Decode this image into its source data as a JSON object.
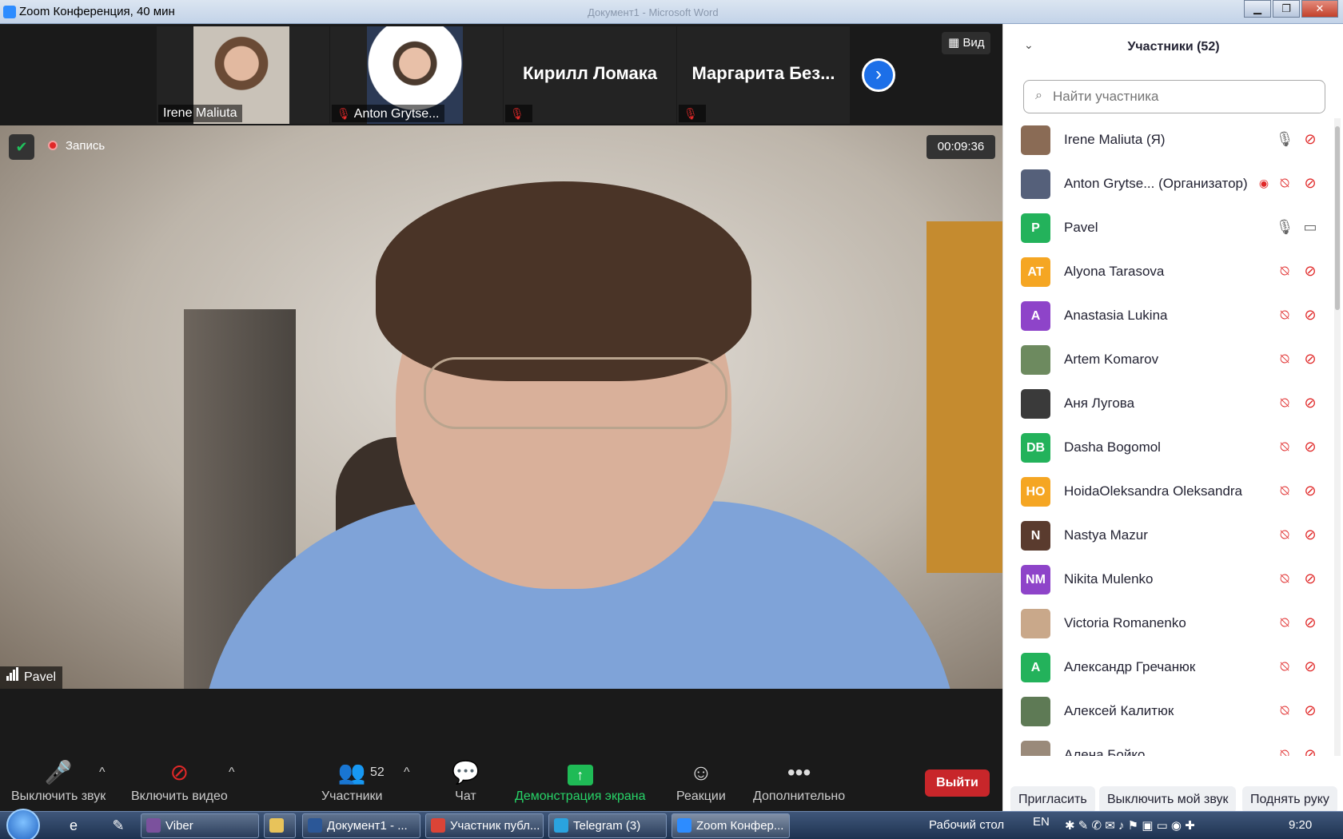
{
  "window": {
    "title": "Zoom Конференция, 40 мин",
    "background_title": "Документ1 - Microsoft Word",
    "min_glyph": "▁",
    "max_glyph": "❐",
    "close_glyph": "✕"
  },
  "strip": {
    "thumbnails": [
      {
        "name": "Irene Maliuta",
        "muted": false
      },
      {
        "name": "Anton Grytse...",
        "muted": true
      },
      {
        "name": "Кирилл Ломака",
        "muted": true
      },
      {
        "name": "Маргарита  Без...",
        "muted": true
      }
    ],
    "next_glyph": "›",
    "view_label": "Вид"
  },
  "video": {
    "recording_label": "Запись",
    "timer": "00:09:36",
    "speaker_name": "Pavel"
  },
  "toolbar": {
    "mute_label": "Выключить звук",
    "video_label": "Включить видео",
    "participants_label": "Участники",
    "participants_count": "52",
    "chat_label": "Чат",
    "share_label": "Демонстрация экрана",
    "reactions_label": "Реакции",
    "more_label": "Дополнительно",
    "leave_label": "Выйти",
    "caret": "^"
  },
  "panel": {
    "title": "Участники (52)",
    "search_placeholder": "Найти участника",
    "participants": [
      {
        "name": "Irene Maliuta (Я)",
        "initials": "",
        "color": "#8a6b55",
        "mic": "on",
        "cam": "off"
      },
      {
        "name": "Anton Grytse... (Организатор)",
        "initials": "",
        "color": "#55607a",
        "mic": "off",
        "cam": "off",
        "recording": true
      },
      {
        "name": "Pavel",
        "initials": "P",
        "color": "#23b25b",
        "mic": "on",
        "cam": "on"
      },
      {
        "name": "Alyona Tarasova",
        "initials": "AT",
        "color": "#f5a623",
        "mic": "off",
        "cam": "off"
      },
      {
        "name": "Anastasia Lukina",
        "initials": "A",
        "color": "#8e44c9",
        "mic": "off",
        "cam": "off"
      },
      {
        "name": "Artem Komarov",
        "initials": "",
        "color": "#6d8a5f",
        "mic": "off",
        "cam": "off"
      },
      {
        "name": "Аня Лугова",
        "initials": "",
        "color": "#3a3a3a",
        "mic": "off",
        "cam": "off"
      },
      {
        "name": "Dasha Bogomol",
        "initials": "DB",
        "color": "#23b25b",
        "mic": "off",
        "cam": "off"
      },
      {
        "name": "HoidaOleksandra Oleksandra",
        "initials": "HO",
        "color": "#f5a623",
        "mic": "off",
        "cam": "off"
      },
      {
        "name": "Nastya Mazur",
        "initials": "N",
        "color": "#5a3b2e",
        "mic": "off",
        "cam": "off"
      },
      {
        "name": "Nikita Mulenko",
        "initials": "NM",
        "color": "#8e44c9",
        "mic": "off",
        "cam": "off"
      },
      {
        "name": "Victoria Romanenko",
        "initials": "",
        "color": "#c9a88a",
        "mic": "off",
        "cam": "off"
      },
      {
        "name": "Александр Гречанюк",
        "initials": "A",
        "color": "#23b25b",
        "mic": "off",
        "cam": "off"
      },
      {
        "name": "Алексей Калитюк",
        "initials": "",
        "color": "#5e7a55",
        "mic": "off",
        "cam": "off"
      },
      {
        "name": "Алена Бойко",
        "initials": "",
        "color": "#9a8a7a",
        "mic": "off",
        "cam": "off"
      }
    ],
    "invite_label": "Пригласить",
    "mute_me_label": "Выключить мой звук",
    "raise_hand_label": "Поднять руку"
  },
  "taskbar": {
    "tasks": [
      {
        "label": "Viber",
        "color": "#7b519d"
      },
      {
        "label": "",
        "color": "#e8c35a"
      },
      {
        "label": "Документ1 - ...",
        "color": "#2b5797"
      },
      {
        "label": "Участник публ...",
        "color": "#db4437"
      },
      {
        "label": "Telegram (3)",
        "color": "#2aa3df"
      },
      {
        "label": "Zoom Конфер...",
        "color": "#2d8cff"
      }
    ],
    "desktop_label": "Рабочий стол",
    "lang": "EN",
    "time": "9:20"
  }
}
